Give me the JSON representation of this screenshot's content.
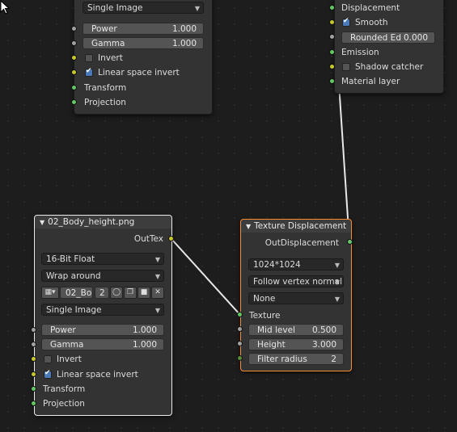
{
  "top_node": {
    "dropdown": "Single Image",
    "power_label": "Power",
    "power_value": "1.000",
    "gamma_label": "Gamma",
    "gamma_value": "1.000",
    "invert_label": "Invert",
    "linear_label": "Linear space invert",
    "transform_label": "Transform",
    "projection_label": "Projection"
  },
  "material_node": {
    "displacement": "Displacement",
    "smooth": "Smooth",
    "rounded_label": "Rounded Ed",
    "rounded_value": "0.000",
    "emission": "Emission",
    "shadow_catcher": "Shadow catcher",
    "material_layer": "Material layer"
  },
  "image_node": {
    "title": "02_Body_height.png",
    "out_socket": "OutTex",
    "bit_depth": "16-Bit Float",
    "wrap": "Wrap around",
    "image_name": "02_Bo",
    "users": "2",
    "projection_mode": "Single Image",
    "power_label": "Power",
    "power_value": "1.000",
    "gamma_label": "Gamma",
    "gamma_value": "1.000",
    "invert_label": "Invert",
    "linear_label": "Linear space invert",
    "transform_label": "Transform",
    "projection_label": "Projection"
  },
  "disp_node": {
    "title": "Texture Displacement",
    "out_socket": "OutDisplacement",
    "resolution": "1024*1024",
    "mode": "Follow vertex normal",
    "filter": "None",
    "texture_label": "Texture",
    "mid_label": "Mid level",
    "mid_value": "0.500",
    "height_label": "Height",
    "height_value": "3.000",
    "radius_label": "Filter radius",
    "radius_value": "2"
  },
  "colors": {
    "socket_green": "#63c763",
    "socket_yellow": "#c7c729",
    "socket_grey": "#a1a1a1",
    "active_border": "#ff8c2a"
  }
}
